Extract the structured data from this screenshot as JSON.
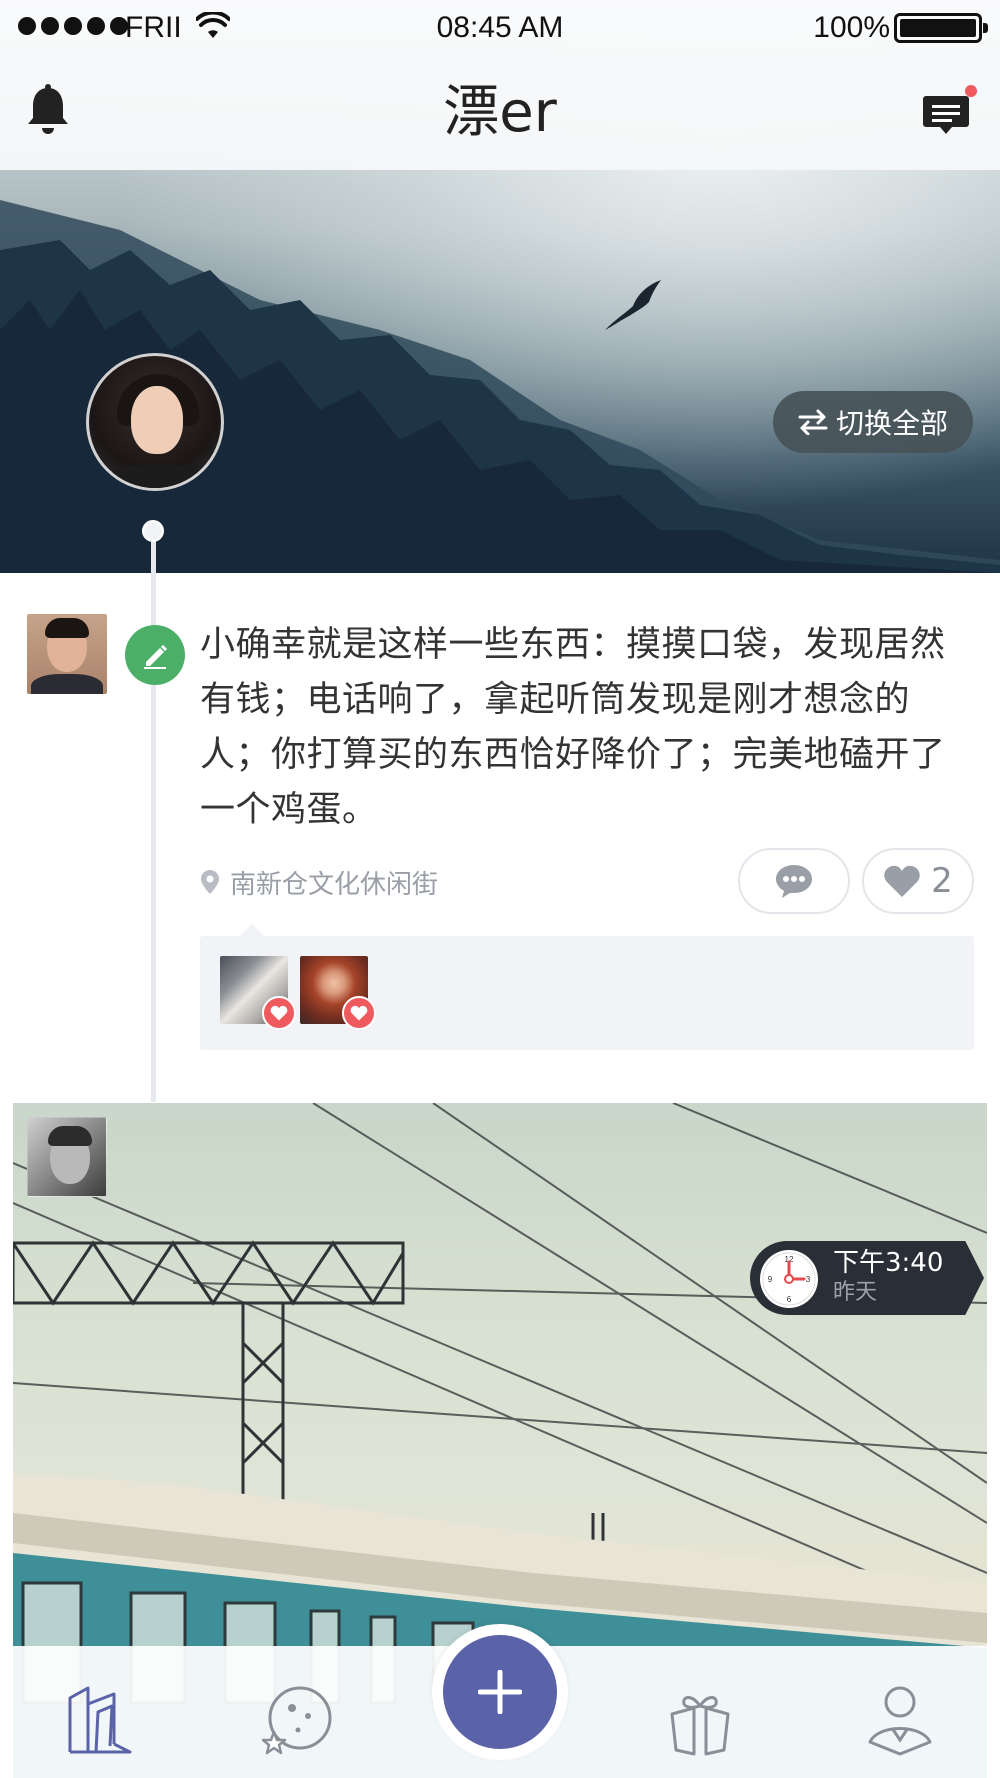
{
  "status_bar": {
    "carrier": "FRII",
    "time": "08:45 AM",
    "battery": "100%"
  },
  "header": {
    "title": "漂er",
    "left_icon": "bell-icon",
    "right_icon": "messages-icon",
    "has_unread_badge": true
  },
  "hero": {
    "switch_label": "切换全部",
    "switch_icon": "swap-arrows-icon"
  },
  "posts": [
    {
      "type": "text",
      "text": "小确幸就是这样一些东西：摸摸口袋，发现居然有钱；电话响了，拿起听筒发现是刚才想念的人；你打算买的东西恰好降价了；完美地磕开了一个鸡蛋。",
      "location": "南新仓文化休闲街",
      "likes": "2",
      "likers": [
        "liker-1",
        "liker-2"
      ]
    },
    {
      "type": "photo",
      "time": "下午3:40",
      "day": "昨天"
    }
  ],
  "tabbar": {
    "items": [
      "home-icon",
      "discover-icon",
      "add-icon",
      "gifts-icon",
      "profile-icon"
    ],
    "accent_color": "#5a62a8"
  },
  "colors": {
    "edit_badge": "#4caf68",
    "heart": "#ef5a5f",
    "time_badge": "#2a2f37"
  }
}
